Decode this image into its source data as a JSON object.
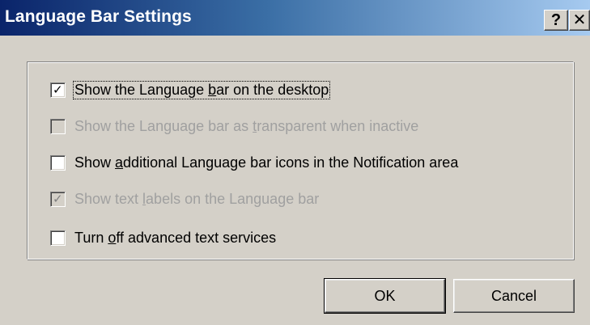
{
  "window": {
    "title": "Language Bar Settings",
    "help_glyph": "?",
    "close_glyph": "✕"
  },
  "options": [
    {
      "label_pre": "Show the Language ",
      "label_key": "b",
      "label_post": "ar on the desktop",
      "checked": true,
      "enabled": true
    },
    {
      "label_pre": "Show the Language bar as ",
      "label_key": "t",
      "label_post": "ransparent when inactive",
      "checked": false,
      "enabled": false
    },
    {
      "label_pre": "Show ",
      "label_key": "a",
      "label_post": "dditional Language bar icons in the Notification area",
      "checked": false,
      "enabled": true
    },
    {
      "label_pre": "Show text ",
      "label_key": "l",
      "label_post": "abels on the Language bar",
      "checked": true,
      "enabled": false
    },
    {
      "label_pre": "Turn ",
      "label_key": "o",
      "label_post": "ff advanced text services",
      "checked": false,
      "enabled": true
    }
  ],
  "buttons": {
    "ok": "OK",
    "cancel": "Cancel"
  },
  "icons": {
    "check": "check-icon",
    "help": "help-icon",
    "close": "close-icon"
  }
}
